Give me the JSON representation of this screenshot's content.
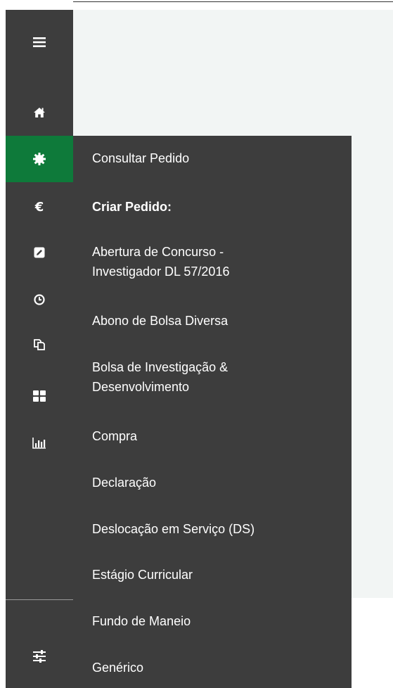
{
  "sidebar": {
    "icons": [
      {
        "name": "menu-icon"
      },
      {
        "name": "home-icon"
      },
      {
        "name": "gear-icon",
        "active": true
      },
      {
        "name": "euro-icon",
        "glyph": "€"
      },
      {
        "name": "edit-icon"
      },
      {
        "name": "clock-icon"
      },
      {
        "name": "copy-icon"
      },
      {
        "name": "grid-icon"
      },
      {
        "name": "bar-chart-icon"
      },
      {
        "name": "sliders-icon"
      }
    ],
    "active_color": "#0e7a3a"
  },
  "menu": {
    "consultar": "Consultar Pedido",
    "criar_header": "Criar Pedido:",
    "items": [
      {
        "line1": "Abertura de Concurso -",
        "line2": "Investigador DL 57/2016"
      },
      {
        "line1": "Abono de Bolsa Diversa"
      },
      {
        "line1": "Bolsa de Investigação &",
        "line2": "Desenvolvimento"
      },
      {
        "line1": "Compra"
      },
      {
        "line1": "Declaração"
      },
      {
        "line1": "Deslocação em Serviço (DS)"
      },
      {
        "line1": "Estágio Curricular"
      },
      {
        "line1": "Fundo de Maneio"
      },
      {
        "line1": "Genérico"
      }
    ]
  }
}
